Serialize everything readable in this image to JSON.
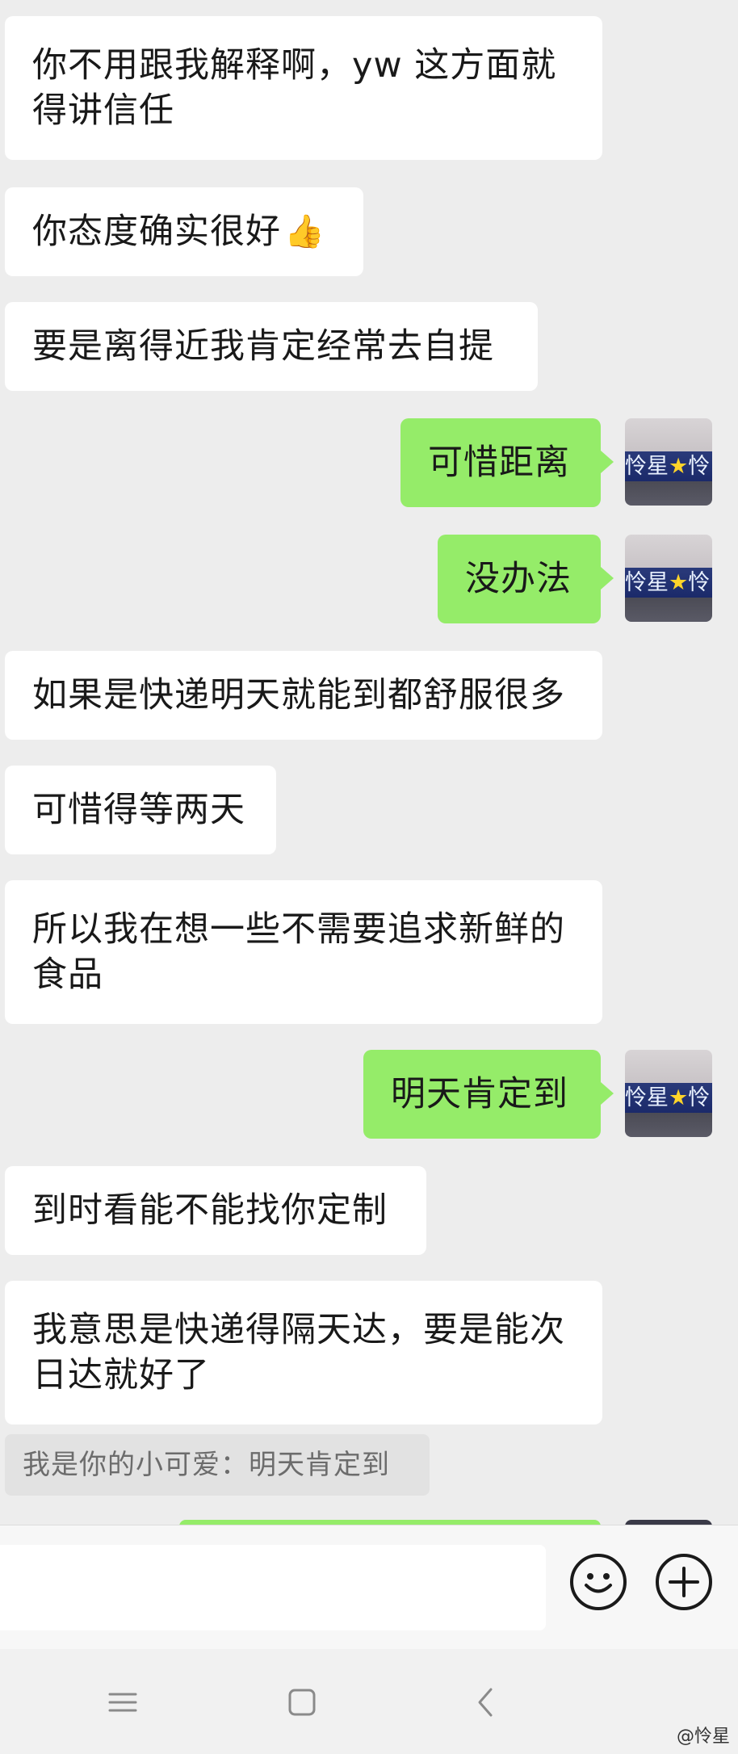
{
  "messages": [
    {
      "side": "in",
      "lines": [
        "你不用跟我解释啊，yw 这方面就",
        "得讲信任"
      ]
    },
    {
      "side": "in",
      "text": "你态度确实很好",
      "emoji": "👍"
    },
    {
      "side": "in",
      "text": "要是离得近我肯定经常去自提"
    },
    {
      "side": "out",
      "text": "可惜距离"
    },
    {
      "side": "out",
      "text": "没办法"
    },
    {
      "side": "in",
      "text": "如果是快递明天就能到都舒服很多"
    },
    {
      "side": "in",
      "text": "可惜得等两天"
    },
    {
      "side": "in",
      "lines": [
        "所以我在想一些不需要追求新鲜的",
        "食品"
      ]
    },
    {
      "side": "out",
      "text": "明天肯定到"
    },
    {
      "side": "in",
      "text": "到时看能不能找你定制"
    },
    {
      "side": "in",
      "lines": [
        "我意思是快递得隔天达，要是能次",
        "日达就好了"
      ]
    }
  ],
  "quote": {
    "text": "我是你的小可爱：明天肯定到"
  },
  "avatar": {
    "text_left": "怜星",
    "star": "★",
    "text_right": "怜"
  },
  "icons": {
    "emoji": "emoji-face-icon",
    "plus": "plus-icon",
    "menu": "menu-icon",
    "home": "home-icon",
    "back": "back-icon"
  },
  "watermark": "@怜星",
  "colors": {
    "background": "#ededed",
    "incoming_bubble": "#ffffff",
    "outgoing_bubble": "#95ec69"
  }
}
